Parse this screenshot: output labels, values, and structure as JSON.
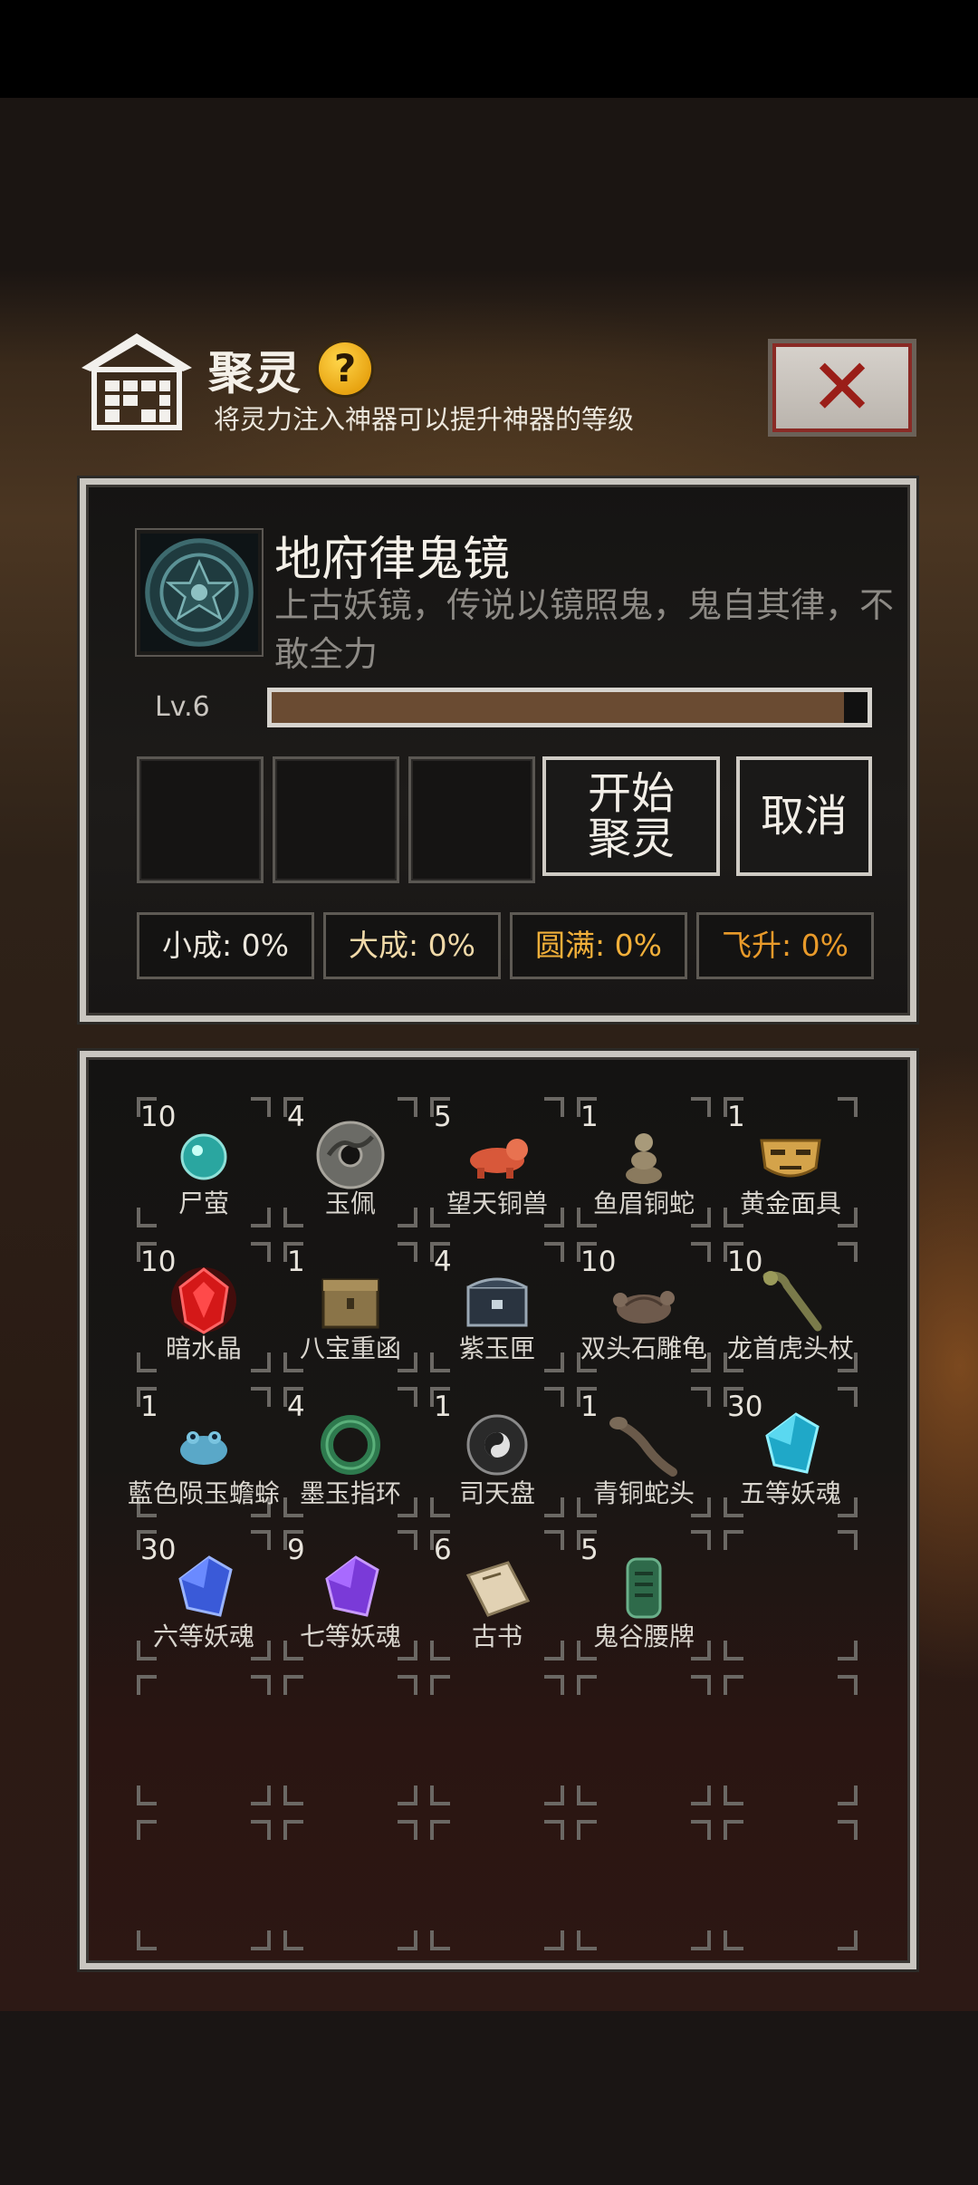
{
  "header": {
    "title": "聚灵",
    "help_glyph": "?",
    "subtitle": "将灵力注入神器可以提升神器的等级",
    "close_glyph": "✕"
  },
  "artifact": {
    "name": "地府律鬼镜",
    "description": "上古妖镜，传说以镜照鬼，鬼自其律，不敢全力",
    "level": "Lv.6",
    "progress_fraction": 0.96
  },
  "actions": {
    "start_label": "开始聚灵",
    "cancel_label": "取消"
  },
  "stages": [
    {
      "label": "小成: 0%",
      "color": "#ece7dd"
    },
    {
      "label": "大成: 0%",
      "color": "#f0d9a8"
    },
    {
      "label": "圆满: 0%",
      "color": "#f2b03a"
    },
    {
      "label": "飞升: 0%",
      "color": "#e89a2a"
    }
  ],
  "inventory": [
    {
      "count": "10",
      "name": "尸萤",
      "icon": "teal-orb-icon"
    },
    {
      "count": "4",
      "name": "玉佩",
      "icon": "jade-disc-icon"
    },
    {
      "count": "5",
      "name": "望天铜兽",
      "icon": "bronze-beast-icon"
    },
    {
      "count": "1",
      "name": "鱼眉铜蛇",
      "icon": "bronze-snake-icon"
    },
    {
      "count": "1",
      "name": "黄金面具",
      "icon": "gold-mask-icon"
    },
    {
      "count": "10",
      "name": "暗水晶",
      "icon": "red-crystal-icon"
    },
    {
      "count": "1",
      "name": "八宝重函",
      "icon": "treasure-box-icon"
    },
    {
      "count": "4",
      "name": "紫玉匣",
      "icon": "jade-chest-icon"
    },
    {
      "count": "10",
      "name": "双头石雕龟",
      "icon": "stone-turtle-icon"
    },
    {
      "count": "10",
      "name": "龙首虎头杖",
      "icon": "dragon-staff-icon"
    },
    {
      "count": "1",
      "name": "藍色陨玉蟾蜍",
      "icon": "blue-toad-icon"
    },
    {
      "count": "4",
      "name": "墨玉指环",
      "icon": "jade-ring-icon"
    },
    {
      "count": "1",
      "name": "司天盘",
      "icon": "bagua-disc-icon"
    },
    {
      "count": "1",
      "name": "青铜蛇头",
      "icon": "bronze-snakehead-icon"
    },
    {
      "count": "30",
      "name": "五等妖魂",
      "icon": "cyan-soul-gem-icon"
    },
    {
      "count": "30",
      "name": "六等妖魂",
      "icon": "blue-soul-gem-icon"
    },
    {
      "count": "9",
      "name": "七等妖魂",
      "icon": "purple-soul-gem-icon"
    },
    {
      "count": "6",
      "name": "古书",
      "icon": "ancient-book-icon"
    },
    {
      "count": "5",
      "name": "鬼谷腰牌",
      "icon": "jade-tablet-icon"
    }
  ]
}
